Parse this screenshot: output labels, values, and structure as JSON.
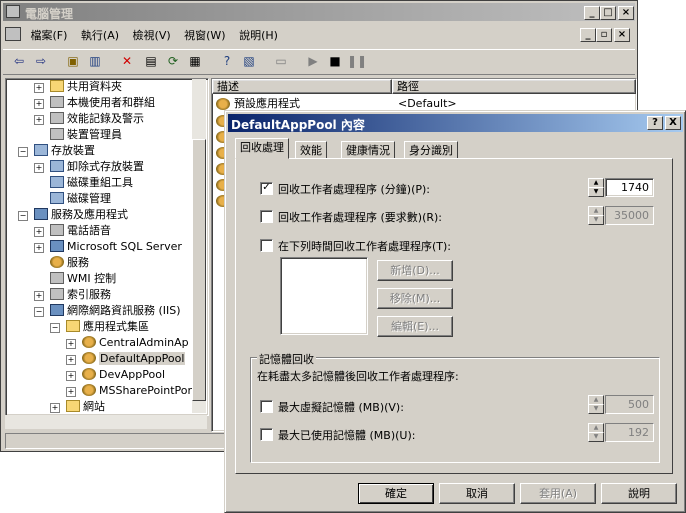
{
  "main_window": {
    "title": "電腦管理",
    "menu": [
      "檔案(F)",
      "執行(A)",
      "檢視(V)",
      "視窗(W)",
      "說明(H)"
    ],
    "tree": [
      {
        "label": "共用資料夾"
      },
      {
        "label": "本機使用者和群組"
      },
      {
        "label": "效能記錄及警示"
      },
      {
        "label": "裝置管理員"
      },
      {
        "label": "存放裝置"
      },
      {
        "label": "卸除式存放裝置"
      },
      {
        "label": "磁碟重組工具"
      },
      {
        "label": "磁碟管理"
      },
      {
        "label": "服務及應用程式"
      },
      {
        "label": "電話語音"
      },
      {
        "label": "Microsoft SQL Server"
      },
      {
        "label": "服務"
      },
      {
        "label": "WMI 控制"
      },
      {
        "label": "索引服務"
      },
      {
        "label": "網際網路資訊服務 (IIS)"
      },
      {
        "label": "應用程式集區"
      },
      {
        "label": "CentralAdminAp"
      },
      {
        "label": "DefaultAppPool"
      },
      {
        "label": "DevAppPool"
      },
      {
        "label": "MSSharePointPor"
      },
      {
        "label": "網站"
      }
    ],
    "list_headers": [
      "描述",
      "路徑"
    ],
    "list_rows": [
      {
        "desc": "預設應用程式",
        "path": "<Default>"
      }
    ]
  },
  "dialog": {
    "title": "DefaultAppPool 內容",
    "help_btn": "?",
    "close_btn": "X",
    "tabs": [
      "回收處理",
      "效能",
      "健康情況",
      "身分識別"
    ],
    "recycle_minutes": {
      "label": "回收工作者處理程序 (分鐘)(P):",
      "checked": true,
      "value": "1740"
    },
    "recycle_requests": {
      "label": "回收工作者處理程序 (要求數)(R):",
      "checked": false,
      "value": "35000"
    },
    "recycle_times": {
      "label": "在下列時間回收工作者處理程序(T):",
      "checked": false
    },
    "add_btn": "新增(D)...",
    "remove_btn": "移除(M)...",
    "edit_btn": "編輯(E)...",
    "memory_group": "記憶體回收",
    "memory_desc": "在耗盡太多記憶體後回收工作者處理程序:",
    "max_virtual": {
      "label": "最大虛擬記憶體 (MB)(V):",
      "checked": false,
      "value": "500"
    },
    "max_used": {
      "label": "最大已使用記憶體 (MB)(U):",
      "checked": false,
      "value": "192"
    },
    "ok_btn": "確定",
    "cancel_btn": "取消",
    "apply_btn": "套用(A)",
    "help_button": "說明"
  }
}
